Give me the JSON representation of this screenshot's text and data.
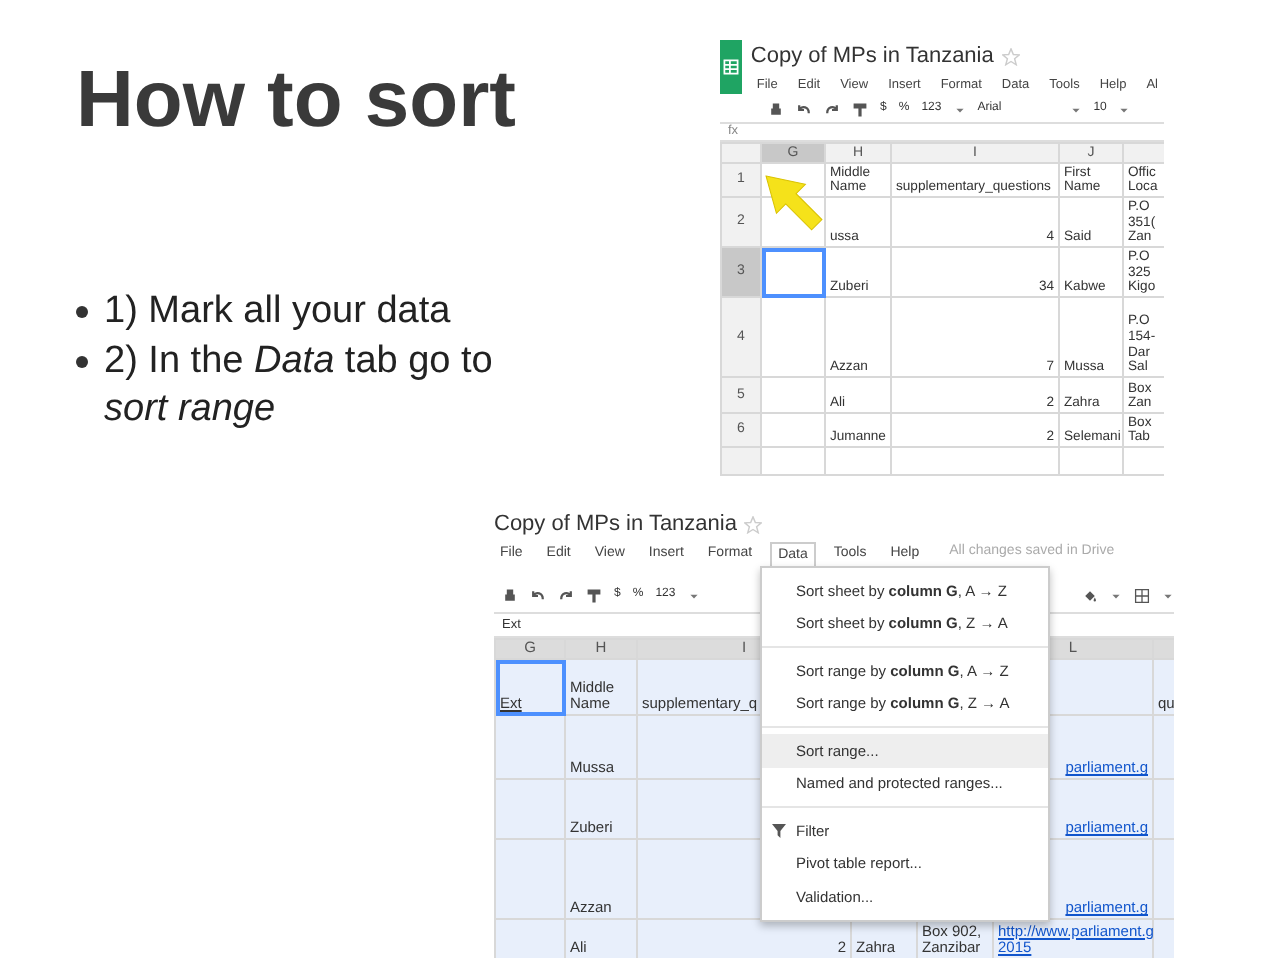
{
  "slide": {
    "title": "How to sort",
    "bullets": [
      {
        "lines": [
          "1) Mark all your data"
        ]
      },
      {
        "lines": [
          "2) In the *Data* tab go to",
          "*sort range*"
        ]
      }
    ]
  },
  "screenshot_1": {
    "title": "Copy of MPs in Tanzania",
    "menu": [
      {
        "label": "File"
      },
      {
        "label": "Edit"
      },
      {
        "label": "View"
      },
      {
        "label": "Insert"
      },
      {
        "label": "Format"
      },
      {
        "label": "Data"
      },
      {
        "label": "Tools"
      },
      {
        "label": "Help"
      },
      {
        "label": "Al"
      }
    ],
    "toolbar": [
      "$",
      "%",
      "123",
      "Arial",
      "10"
    ],
    "formula_label": "fx",
    "columns": [
      "G",
      "H",
      "I",
      "J"
    ],
    "rows": [
      {
        "number": "1",
        "selected": false,
        "h": "Middle Name",
        "i": "supplementary_questions",
        "j": "First Name",
        "k": [
          "Offic",
          "Loca"
        ]
      },
      {
        "number": "2",
        "selected": false,
        "h": "ussa",
        "i": "4",
        "j": "Said",
        "k": [
          "P.O",
          "351(",
          "Zan"
        ]
      },
      {
        "number": "3",
        "selected": true,
        "h": "Zuberi",
        "i": "34",
        "j": "Kabwe",
        "k": [
          "P.O",
          "325",
          "Kigo"
        ]
      },
      {
        "number": "4",
        "selected": false,
        "h": "Azzan",
        "i": "7",
        "j": "Mussa",
        "k": [
          "P.O",
          "154-",
          "Dar",
          "Sal"
        ]
      },
      {
        "number": "5",
        "selected": false,
        "h": "Ali",
        "i": "2",
        "j": "Zahra",
        "k": [
          "Box",
          "Zan"
        ]
      },
      {
        "number": "6",
        "selected": false,
        "h": "Jumanne",
        "i": "2",
        "j": "Selemani",
        "k": [
          "Box",
          "Tab"
        ]
      }
    ]
  },
  "screenshot_2": {
    "title": "Copy of MPs in Tanzania",
    "menu": [
      {
        "label": "File",
        "selected": false
      },
      {
        "label": "Edit",
        "selected": false
      },
      {
        "label": "View",
        "selected": false
      },
      {
        "label": "Insert",
        "selected": false
      },
      {
        "label": "Format",
        "selected": false
      },
      {
        "label": "Data",
        "selected": true
      },
      {
        "label": "Tools",
        "selected": false
      },
      {
        "label": "Help",
        "selected": false
      }
    ],
    "save_status": "All changes saved in Drive",
    "toolbar": [
      "$",
      "%",
      "123"
    ],
    "formula_value": "Ext",
    "columns": [
      "G",
      "H",
      "I",
      "L"
    ],
    "rows": [
      {
        "selected": true,
        "g": "Ext",
        "h": "Middle Name",
        "i": "supplementary_q",
        "m": "qu"
      },
      {
        "selected": true,
        "h": "Mussa",
        "l": [
          "parliament.g"
        ]
      },
      {
        "selected": true,
        "h": "Zuberi",
        "l": [
          "parliament.g"
        ]
      },
      {
        "selected": true,
        "h": "Azzan",
        "l": [
          "parliament.g"
        ]
      },
      {
        "selected": true,
        "h": "Ali",
        "i": "2",
        "j": "Zahra",
        "k": "Box 902, Zanzibar",
        "l": [
          "http://www.parliament.g",
          "2015"
        ]
      }
    ],
    "data_menu": [
      {
        "kind": "item",
        "label": "Sort sheet by **column G**, A → Z",
        "selected": false
      },
      {
        "kind": "item",
        "label": "Sort sheet by **column G**, Z → A",
        "selected": false
      },
      {
        "kind": "divider"
      },
      {
        "kind": "item",
        "label": "Sort range by **column G**, A → Z",
        "selected": false
      },
      {
        "kind": "item",
        "label": "Sort range by **column G**, Z → A",
        "selected": false
      },
      {
        "kind": "divider"
      },
      {
        "kind": "item",
        "label": "Sort range...",
        "selected": true
      },
      {
        "kind": "item",
        "label": "Named and protected ranges...",
        "selected": false
      },
      {
        "kind": "divider"
      },
      {
        "kind": "filter",
        "label": "Filter",
        "selected": false
      },
      {
        "kind": "item",
        "label": "Pivot table report...",
        "selected": false
      },
      {
        "kind": "item",
        "label": "Validation...",
        "selected": false
      }
    ]
  }
}
